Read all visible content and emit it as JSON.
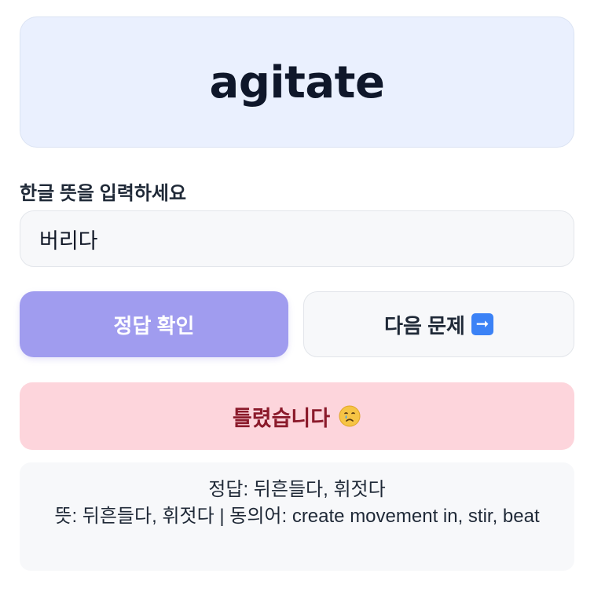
{
  "quiz": {
    "word": "agitate",
    "answer_label": "한글 뜻을 입력하세요",
    "answer_value": "버리다"
  },
  "buttons": {
    "check_label": "정답 확인",
    "next_label": "다음 문제",
    "next_icon": "right-arrow-icon"
  },
  "result": {
    "message": "틀렸습니다",
    "icon": "crying-face-icon"
  },
  "detail": {
    "answer_line": "정답: 뒤흔들다, 휘젓다",
    "meaning_line": "뜻: 뒤흔들다, 휘젓다 | 동의어: create movement in, stir, beat"
  },
  "colors": {
    "word_card_bg": "#eaf0fe",
    "check_button_bg": "#a09cef",
    "result_bg": "#fdd5dc",
    "result_text": "#8b1a2b"
  }
}
